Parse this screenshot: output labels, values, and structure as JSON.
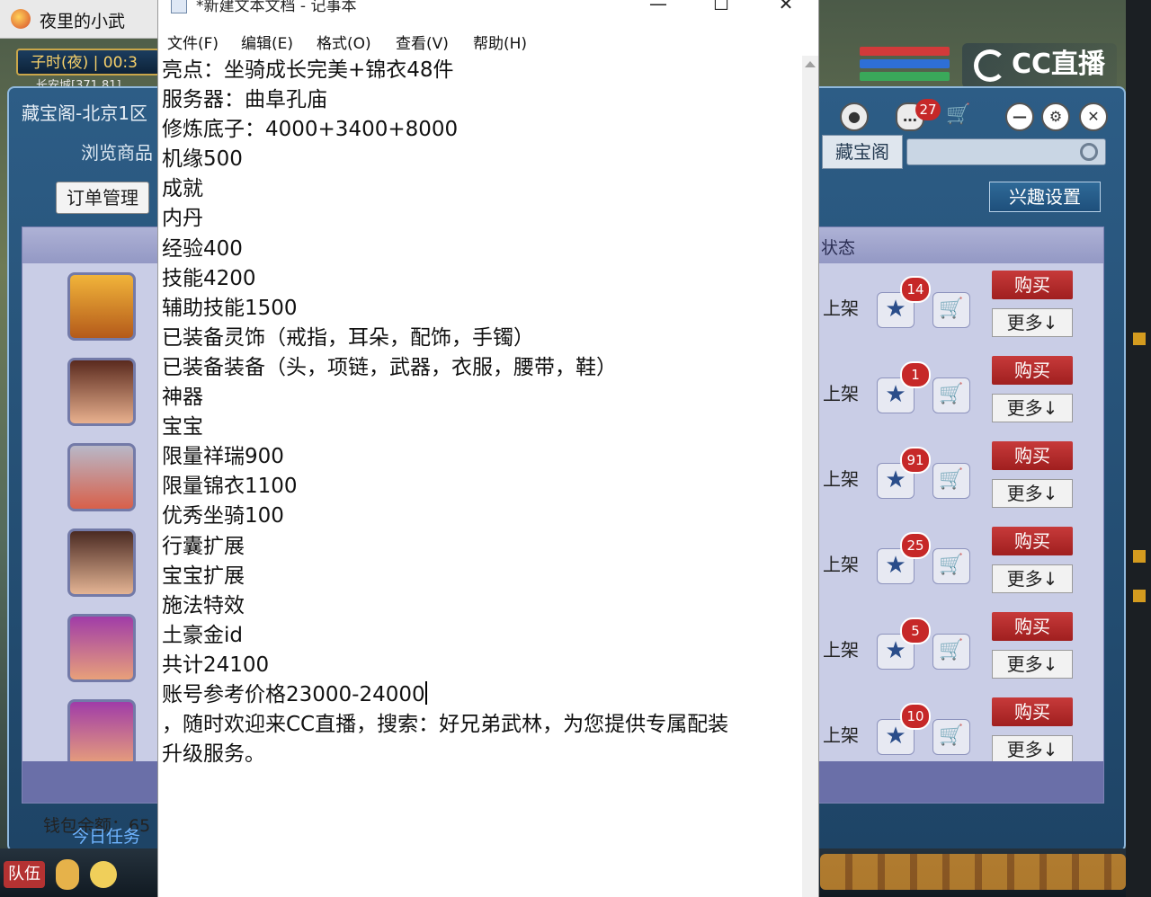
{
  "game": {
    "window_title": "夜里的小武",
    "time_label": "子时(夜) | 00:3",
    "coord_text": "长安城[371,81]",
    "treasure": {
      "title": "藏宝阁-北京1区",
      "browse_tab": "浏览商品",
      "order_button": "订单管理",
      "tab_label": "藏宝阁",
      "interest_button": "兴趣设置",
      "status_header": "状态",
      "message_count": "27",
      "wallet_label": "钱包余额：65",
      "daily_label": "今日任务",
      "rows": [
        {
          "status": "上架",
          "fav_count": "14",
          "buy": "购买",
          "more": "更多↓"
        },
        {
          "status": "上架",
          "fav_count": "1",
          "buy": "购买",
          "more": "更多↓"
        },
        {
          "status": "上架",
          "fav_count": "91",
          "buy": "购买",
          "more": "更多↓"
        },
        {
          "status": "上架",
          "fav_count": "25",
          "buy": "购买",
          "more": "更多↓"
        },
        {
          "status": "上架",
          "fav_count": "5",
          "buy": "购买",
          "more": "更多↓"
        },
        {
          "status": "上架",
          "fav_count": "10",
          "buy": "购买",
          "more": "更多↓"
        }
      ]
    },
    "cc_logo": "CC直播",
    "team_button": "队伍",
    "colors": {
      "buy_red": "#b32a2a",
      "badge_red": "#c62828",
      "list_bg": "#c9cde6"
    }
  },
  "notepad": {
    "title": "*新建文本文档 - 记事本",
    "menu": [
      "文件(F)",
      "编辑(E)",
      "格式(O)",
      "查看(V)",
      "帮助(H)"
    ],
    "lines": [
      "亮点：坐骑成长完美+锦衣48件",
      "服务器：曲阜孔庙",
      "修炼底子：4000+3400+8000",
      "机缘500",
      "成就",
      "内丹",
      "经验400",
      "技能4200",
      "辅助技能1500",
      "已装备灵饰（戒指，耳朵，配饰，手镯）",
      "已装备装备（头，项链，武器，衣服，腰带，鞋）",
      "神器",
      "宝宝",
      "限量祥瑞900",
      "限量锦衣1100",
      "优秀坐骑100",
      "行囊扩展",
      "宝宝扩展",
      "施法特效",
      "土豪金id",
      "共计24100",
      "账号参考价格23000-24000",
      "，随时欢迎来CC直播，搜索：好兄弟武林，为您提供专属配装",
      "升级服务。"
    ]
  }
}
